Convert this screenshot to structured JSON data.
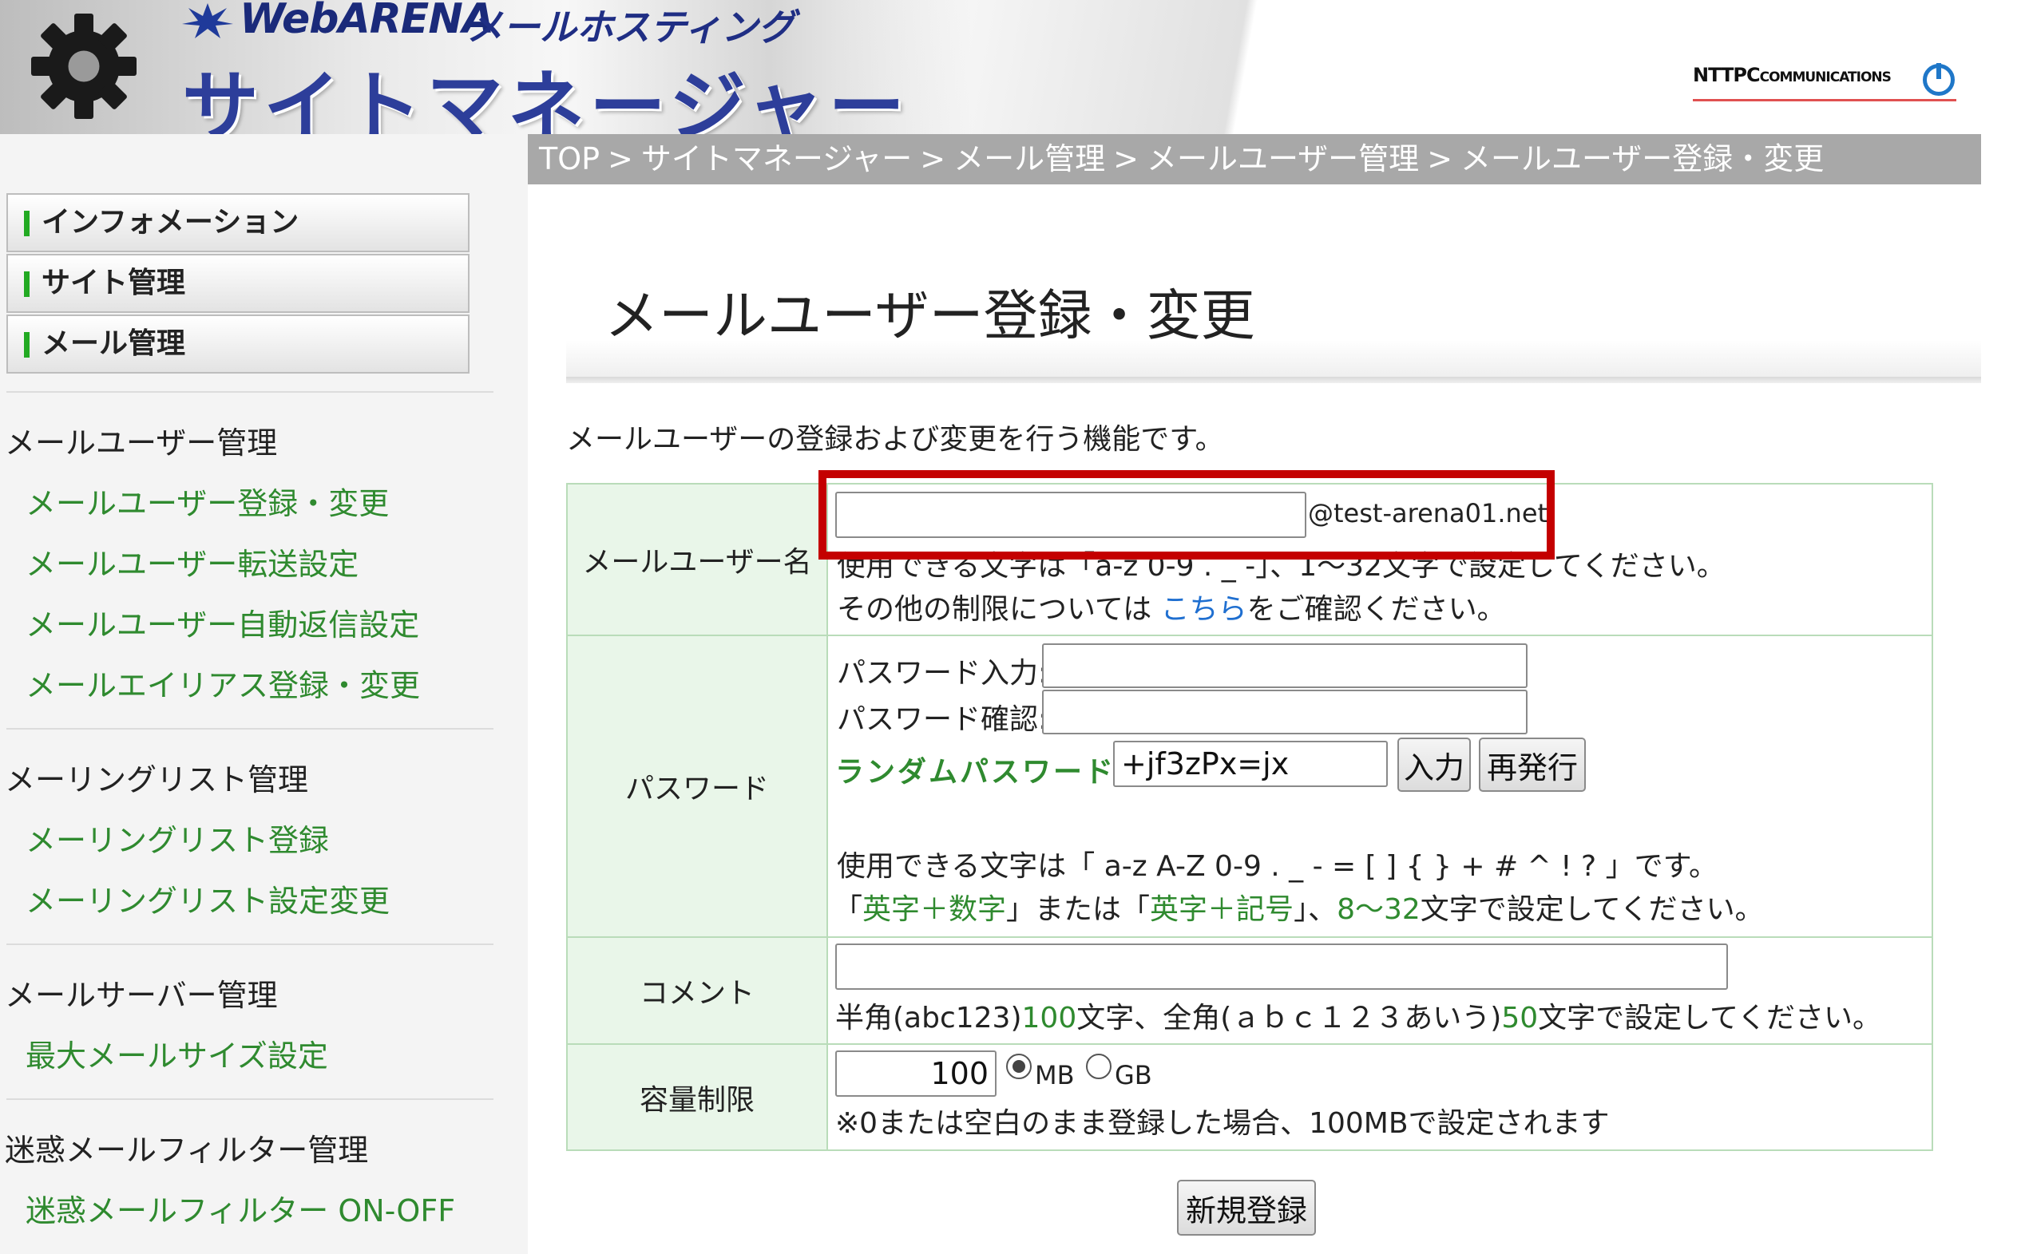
{
  "header": {
    "brand_webarena": "WebARENA",
    "brand_hosting": "メールホスティング",
    "app_title": "サイトマネージャー",
    "ntt_logo_main": "NTTPC",
    "ntt_logo_sub": "COMMUNICATIONS"
  },
  "breadcrumb": [
    "TOP",
    "サイトマネージャー",
    "メール管理",
    "メールユーザー管理",
    "メールユーザー登録・変更"
  ],
  "breadcrumb_sep": ">",
  "sidebar": {
    "menu_buttons": [
      "インフォメーション",
      "サイト管理",
      "メール管理"
    ],
    "sections": [
      {
        "heading": "メールユーザー管理",
        "links": [
          "メールユーザー登録・変更",
          "メールユーザー転送設定",
          "メールユーザー自動返信設定",
          "メールエイリアス登録・変更"
        ]
      },
      {
        "heading": "メーリングリスト管理",
        "links": [
          "メーリングリスト登録",
          "メーリングリスト設定変更"
        ]
      },
      {
        "heading": "メールサーバー管理",
        "links": [
          "最大メールサイズ設定"
        ]
      },
      {
        "heading": "迷惑メールフィルター管理",
        "links": [
          "迷惑メールフィルター ON-OFF"
        ]
      }
    ]
  },
  "main": {
    "title": "メールユーザー登録・変更",
    "description": "メールユーザーの登録および変更を行う機能です。",
    "username": {
      "label": "メールユーザー名",
      "value": "",
      "domain": "@test-arena01.net",
      "hint1": "使用できる文字は「a-z 0-9 . _ -」、1～32文字で設定してください。",
      "hint2_pre": "その他の制限については ",
      "hint2_link": "こちら",
      "hint2_post": "をご確認ください。"
    },
    "password": {
      "label": "パスワード",
      "input_label": "パスワード入力:",
      "confirm_label": "パスワード確認:",
      "input_value": "",
      "confirm_value": "",
      "random_label": "ランダムパスワード:",
      "random_value": "+jf3zPx=jx",
      "fill_button": "入力",
      "regen_button": "再発行",
      "hint1": "使用できる文字は「 a-z A-Z 0-9 . _ - = [ ] { } + # ^ ! ? 」です。",
      "hint2_a": "「",
      "hint2_b": "英字＋数字",
      "hint2_c": "」または「",
      "hint2_d": "英字＋記号",
      "hint2_e": "」、",
      "hint2_f": "8～32",
      "hint2_g": "文字で設定してください。"
    },
    "comment": {
      "label": "コメント",
      "value": "",
      "hint_a": "半角(abc123)",
      "hint_b": "100",
      "hint_c": "文字、全角(ａｂｃ１２３あいう)",
      "hint_d": "50",
      "hint_e": "文字で設定してください。"
    },
    "quota": {
      "label": "容量制限",
      "value": "100",
      "unit_mb": "MB",
      "unit_gb": "GB",
      "selected_unit": "MB",
      "note": "※0または空白のまま登録した場合、100MBで設定されます"
    },
    "submit_button": "新規登録"
  },
  "colors": {
    "accent_green": "#2f8a2f",
    "link_blue": "#1f6fd0",
    "highlight_red": "#c40000",
    "label_bg": "#e9f6e9"
  }
}
